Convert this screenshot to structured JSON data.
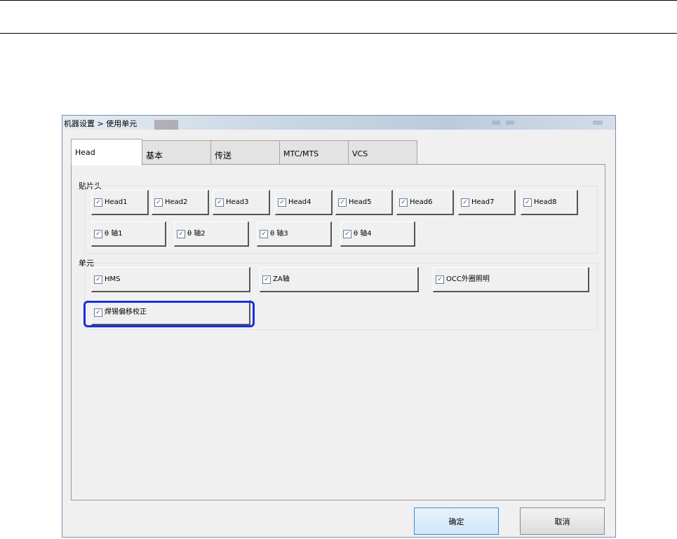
{
  "dialog": {
    "title": "机器设置 > 使用单元"
  },
  "tabs": [
    {
      "label": "Head",
      "active": true
    },
    {
      "label": "基本",
      "active": false
    },
    {
      "label": "传送",
      "active": false
    },
    {
      "label": "MTC/MTS",
      "active": false
    },
    {
      "label": "VCS",
      "active": false
    }
  ],
  "head_group": {
    "label": "贴片头",
    "heads": [
      "Head1",
      "Head2",
      "Head3",
      "Head4",
      "Head5",
      "Head6",
      "Head7",
      "Head8"
    ],
    "axes": [
      "θ 轴1",
      "θ 轴2",
      "θ 轴3",
      "θ 轴4"
    ]
  },
  "unit_group": {
    "label": "单元",
    "items": [
      "HMS",
      "ZA轴",
      "OCC外圈照明",
      "焊锡偏移校正"
    ]
  },
  "checkbox_state": "checked",
  "check_mark": "✓",
  "highlight_color": "#1a2de0",
  "buttons": {
    "ok": "确定",
    "cancel": "取消"
  }
}
